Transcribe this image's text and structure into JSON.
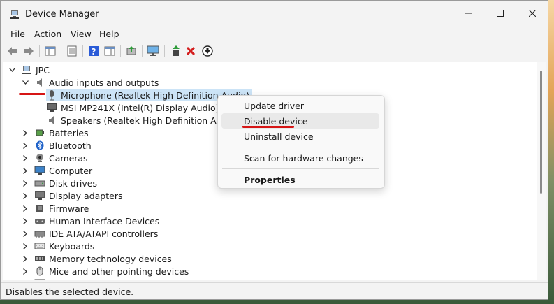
{
  "window": {
    "title": "Device Manager",
    "controls": {
      "minimize": "—",
      "maximize": "☐",
      "close": "✕"
    }
  },
  "menu": [
    "File",
    "Action",
    "View",
    "Help"
  ],
  "toolbar_icons": [
    "back-arrow-icon",
    "forward-arrow-icon",
    "show-hide-console-tree-icon",
    "properties-icon",
    "help-icon",
    "action-pane-icon",
    "update-driver-icon",
    "monitor-scan-icon",
    "enable-device-icon",
    "uninstall-device-icon",
    "disable-device-icon"
  ],
  "tree": {
    "root": "JPC",
    "audio": {
      "label": "Audio inputs and outputs",
      "children": [
        "Microphone (Realtek High Definition Audio)",
        "MSI MP241X (Intel(R) Display Audio)",
        "Speakers (Realtek High Definition Audio)"
      ]
    },
    "categories": [
      "Batteries",
      "Bluetooth",
      "Cameras",
      "Computer",
      "Disk drives",
      "Display adapters",
      "Firmware",
      "Human Interface Devices",
      "IDE ATA/ATAPI controllers",
      "Keyboards",
      "Memory technology devices",
      "Mice and other pointing devices"
    ]
  },
  "context_menu": {
    "update_driver": "Update driver",
    "disable_device": "Disable device",
    "uninstall_device": "Uninstall device",
    "scan": "Scan for hardware changes",
    "properties": "Properties"
  },
  "status": "Disables the selected device.",
  "colors": {
    "selection": "#cce4f7",
    "annotation": "#d61515",
    "toolbar_red_x": "#d41f1f",
    "toolbar_green_arrow": "#2e9b3a",
    "help_blue": "#2a5bd7"
  }
}
